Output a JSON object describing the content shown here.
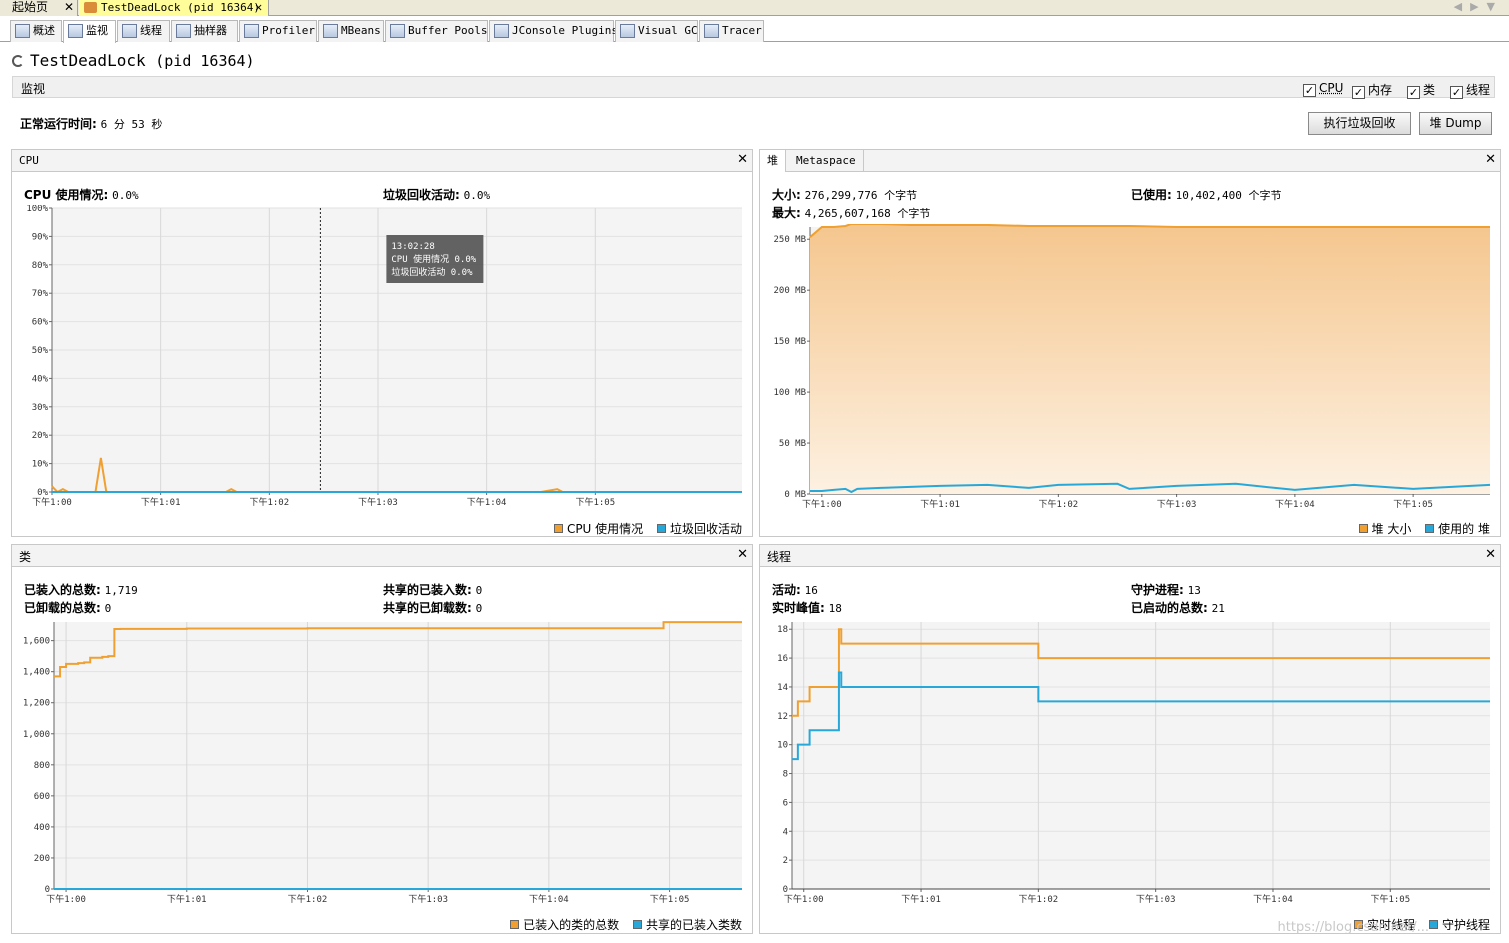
{
  "doc_tabs": [
    {
      "label": "起始页",
      "close": "✕"
    },
    {
      "label": "TestDeadLock (pid 16364)",
      "close": "✕"
    }
  ],
  "view_tabs": [
    {
      "label": "概述",
      "icon": "overview-icon"
    },
    {
      "label": "监视",
      "icon": "monitor-icon"
    },
    {
      "label": "线程",
      "icon": "threads-icon"
    },
    {
      "label": "抽样器",
      "icon": "sampler-icon"
    },
    {
      "label": "Profiler",
      "icon": "profiler-icon"
    },
    {
      "label": "MBeans",
      "icon": "mbeans-icon"
    },
    {
      "label": "Buffer Pools",
      "icon": "buffer-pools-icon"
    },
    {
      "label": "JConsole Plugins",
      "icon": "jconsole-icon"
    },
    {
      "label": "Visual GC",
      "icon": "visual-gc-icon"
    },
    {
      "label": "Tracer",
      "icon": "tracer-icon"
    }
  ],
  "active_view_tab": "监视",
  "app": {
    "name": "TestDeadLock",
    "pid": "(pid 16364)"
  },
  "section": {
    "title": "监视",
    "checkboxes": [
      {
        "label": "CPU",
        "checked": true
      },
      {
        "label": "内存",
        "checked": true
      },
      {
        "label": "类",
        "checked": true
      },
      {
        "label": "线程",
        "checked": true
      }
    ]
  },
  "uptime": {
    "label": "正常运行时间:",
    "value": "6 分 53 秒"
  },
  "buttons": {
    "gc": "执行垃圾回收",
    "dump": "堆 Dump"
  },
  "colors": {
    "orange": "#f0a030",
    "blue": "#28a8d8"
  },
  "cpu": {
    "title": "CPU",
    "close": "✕",
    "usage_label": "CPU 使用情况:",
    "usage_value": "0.0%",
    "gc_label": "垃圾回收活动:",
    "gc_value": "0.0%",
    "tooltip": {
      "time": "13:02:28",
      "line1_label": "CPU 使用情况",
      "line1_value": "0.0%",
      "line2_label": "垃圾回收活动",
      "line2_value": "0.0%"
    },
    "legend": [
      "CPU 使用情况",
      "垃圾回收活动"
    ]
  },
  "heap": {
    "tab_heap": "堆",
    "tab_metaspace": "Metaspace",
    "close": "✕",
    "size_label": "大小:",
    "size_value": "276,299,776 个字节",
    "max_label": "最大:",
    "max_value": "4,265,607,168 个字节",
    "used_label": "已使用:",
    "used_value": "10,402,400 个字节",
    "legend": [
      "堆 大小",
      "使用的 堆"
    ]
  },
  "classes": {
    "title": "类",
    "close": "✕",
    "loaded_label": "已装入的总数:",
    "loaded_value": "1,719",
    "unloaded_label": "已卸载的总数:",
    "unloaded_value": "0",
    "shared_loaded_label": "共享的已装入数:",
    "shared_loaded_value": "0",
    "shared_unloaded_label": "共享的已卸载数:",
    "shared_unloaded_value": "0",
    "legend": [
      "已装入的类的总数",
      "共享的已装入类数"
    ]
  },
  "threads": {
    "title": "线程",
    "close": "✕",
    "live_label": "活动:",
    "live_value": "16",
    "peak_label": "实时峰值:",
    "peak_value": "18",
    "daemon_label": "守护进程:",
    "daemon_value": "13",
    "started_label": "已启动的总数:",
    "started_value": "21",
    "legend": [
      "实时线程",
      "守护线程"
    ]
  },
  "chart_data": [
    {
      "type": "line",
      "id": "cpu",
      "x_ticks": [
        "下午1:00",
        "下午1:01",
        "下午1:02",
        "下午1:03",
        "下午1:04",
        "下午1:05"
      ],
      "y_ticks": [
        "0%",
        "10%",
        "20%",
        "30%",
        "40%",
        "50%",
        "60%",
        "70%",
        "80%",
        "90%",
        "100%"
      ],
      "xlim": [
        0,
        6.35
      ],
      "ylim": [
        0,
        100
      ],
      "x": [
        0,
        0.05,
        0.1,
        0.15,
        0.2,
        0.3,
        0.4,
        0.45,
        0.5,
        0.55,
        0.6,
        0.8,
        1.0,
        1.3,
        1.6,
        1.65,
        1.7,
        2.0,
        2.5,
        3.0,
        3.5,
        4.0,
        4.5,
        4.65,
        4.7,
        5.0,
        5.8,
        6.35
      ],
      "series": [
        {
          "name": "CPU 使用情况",
          "values": [
            2,
            0,
            1,
            0,
            0,
            0,
            0,
            12,
            0,
            0,
            0,
            0,
            0,
            0,
            0,
            1,
            0,
            0,
            0,
            0,
            0,
            0,
            0,
            1,
            0,
            0,
            0,
            0
          ]
        },
        {
          "name": "垃圾回收活动",
          "values": [
            0,
            0,
            0,
            0,
            0,
            0,
            0,
            0,
            0,
            0,
            0,
            0,
            0,
            0,
            0,
            0,
            0,
            0,
            0,
            0,
            0,
            0,
            0,
            0,
            0,
            0,
            0,
            0
          ]
        }
      ],
      "cursor_x": 2.47,
      "grid": true
    },
    {
      "type": "area",
      "id": "heap",
      "x_ticks": [
        "下午1:00",
        "下午1:01",
        "下午1:02",
        "下午1:03",
        "下午1:04",
        "下午1:05"
      ],
      "y_ticks": [
        "0 MB",
        "50 MB",
        "100 MB",
        "150 MB",
        "200 MB",
        "250 MB"
      ],
      "xlim": [
        -0.1,
        5.65
      ],
      "ylim": [
        0,
        262
      ],
      "x": [
        -0.1,
        0.0,
        0.1,
        0.2,
        0.25,
        0.3,
        0.5,
        0.75,
        1.0,
        1.4,
        1.75,
        2.0,
        2.5,
        2.6,
        3.0,
        3.5,
        4.0,
        4.5,
        5.0,
        5.65
      ],
      "series": [
        {
          "name": "堆 大小",
          "values": [
            252,
            262,
            262,
            263,
            265,
            265,
            265,
            264,
            264,
            264,
            263,
            263,
            263,
            263,
            262,
            262,
            262,
            262,
            262,
            262
          ]
        },
        {
          "name": "使用的 堆",
          "values": [
            3,
            3,
            4,
            5,
            2,
            5,
            6,
            7,
            8,
            9,
            6,
            9,
            10,
            5,
            8,
            10,
            4,
            9,
            5,
            9
          ]
        }
      ],
      "grid": true
    },
    {
      "type": "line",
      "id": "classes",
      "x_ticks": [
        "下午1:00",
        "下午1:01",
        "下午1:02",
        "下午1:03",
        "下午1:04",
        "下午1:05"
      ],
      "y_ticks": [
        "0",
        "200",
        "400",
        "600",
        "800",
        "1,000",
        "1,200",
        "1,400",
        "1,600"
      ],
      "xlim": [
        -0.1,
        5.6
      ],
      "ylim": [
        0,
        1720
      ],
      "x": [
        -0.1,
        -0.05,
        0.0,
        0.1,
        0.15,
        0.2,
        0.3,
        0.35,
        0.4,
        0.45,
        1.0,
        2.0,
        3.0,
        4.0,
        4.9,
        4.95,
        5.6
      ],
      "series": [
        {
          "name": "已装入的类的总数",
          "values": [
            1370,
            1430,
            1450,
            1455,
            1460,
            1490,
            1495,
            1500,
            1675,
            1676,
            1678,
            1680,
            1680,
            1680,
            1680,
            1719,
            1719
          ]
        },
        {
          "name": "共享的已装入类数",
          "values": [
            0,
            0,
            0,
            0,
            0,
            0,
            0,
            0,
            0,
            0,
            0,
            0,
            0,
            0,
            0,
            0,
            0
          ]
        }
      ],
      "grid": true
    },
    {
      "type": "line",
      "id": "threads",
      "x_ticks": [
        "下午1:00",
        "下午1:01",
        "下午1:02",
        "下午1:03",
        "下午1:04",
        "下午1:05"
      ],
      "y_ticks": [
        "0",
        "2",
        "4",
        "6",
        "8",
        "10",
        "12",
        "14",
        "16",
        "18"
      ],
      "xlim": [
        -0.1,
        5.85
      ],
      "ylim": [
        0,
        18.5
      ],
      "x": [
        -0.1,
        -0.05,
        0.0,
        0.05,
        0.1,
        0.28,
        0.3,
        0.32,
        0.35,
        1.0,
        1.95,
        2.0,
        3.0,
        4.0,
        5.0,
        5.85
      ],
      "series": [
        {
          "name": "实时线程",
          "values": [
            12,
            13,
            13,
            14,
            14,
            14,
            18,
            17,
            17,
            17,
            17,
            16,
            16,
            16,
            16,
            16
          ]
        },
        {
          "name": "守护线程",
          "values": [
            9,
            10,
            10,
            11,
            11,
            11,
            15,
            14,
            14,
            14,
            14,
            13,
            13,
            13,
            13,
            13
          ]
        }
      ],
      "grid": true
    }
  ],
  "watermark": "https://blog.csdn.net/..."
}
